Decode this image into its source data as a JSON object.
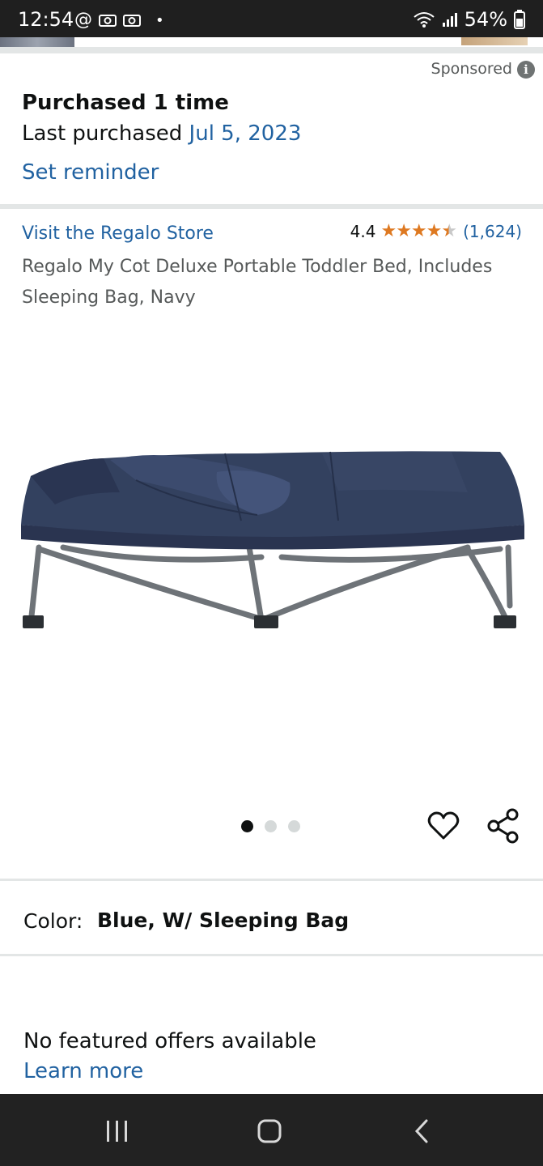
{
  "status_bar": {
    "time": "12:54",
    "dot": "•",
    "battery": "54%"
  },
  "sponsored": {
    "label": "Sponsored",
    "info_glyph": "i"
  },
  "purchase": {
    "heading": "Purchased 1 time",
    "last_purchased_label": "Last purchased",
    "last_purchased_date": "Jul 5, 2023",
    "reminder_link": "Set reminder"
  },
  "product": {
    "store_link": "Visit the Regalo Store",
    "rating": "4.4",
    "rating_value": 4.4,
    "review_count": "(1,624)",
    "title": "Regalo My Cot Deluxe Portable Toddler Bed, Includes Sleeping Bag, Navy",
    "image_pages": 3,
    "active_image": 1
  },
  "variant": {
    "label": "Color:",
    "value": "Blue, W/ Sleeping Bag"
  },
  "offers": {
    "message": "No featured offers available",
    "learn_more": "Learn more"
  },
  "colors": {
    "link": "#2162a1",
    "star": "#de7921",
    "text": "#0f1111",
    "muted": "#565959"
  }
}
